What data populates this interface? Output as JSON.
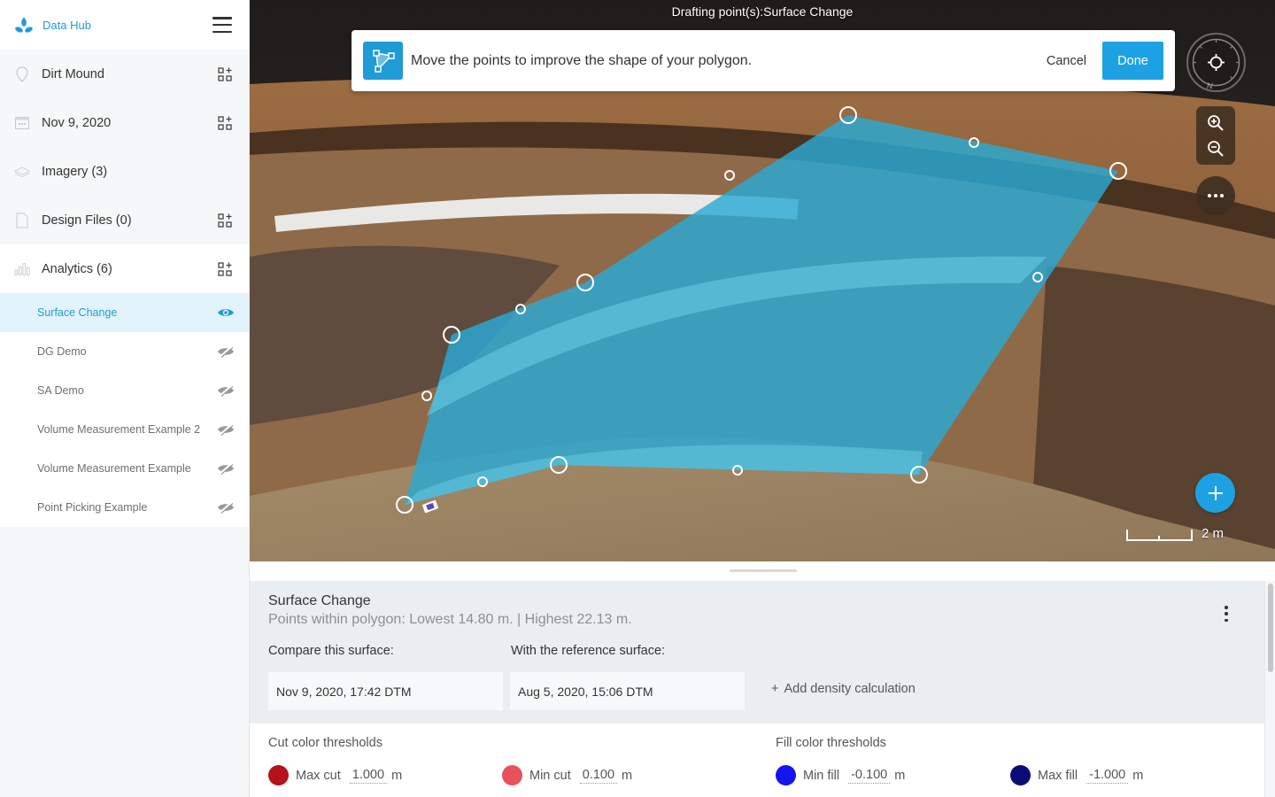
{
  "sidebar": {
    "app_title": "Data Hub",
    "logo_icon": "data-hub-logo-icon",
    "menu_icon": "hamburger-menu-icon",
    "items": [
      {
        "label": "Dirt Mound",
        "icon": "location-pin-icon",
        "has_add": true
      },
      {
        "label": "Nov 9, 2020",
        "icon": "calendar-icon",
        "has_add": true
      },
      {
        "label": "Imagery (3)",
        "icon": "layers-icon",
        "has_add": false
      },
      {
        "label": "Design Files (0)",
        "icon": "file-icon",
        "has_add": true
      },
      {
        "label": "Analytics (6)",
        "icon": "bar-chart-icon",
        "has_add": true
      }
    ],
    "analytics": [
      {
        "label": "Surface Change",
        "visible": true,
        "active": true
      },
      {
        "label": "DG Demo",
        "visible": false
      },
      {
        "label": "SA Demo",
        "visible": false
      },
      {
        "label": "Volume Measurement Example 2",
        "visible": false
      },
      {
        "label": "Volume Measurement Example",
        "visible": false
      },
      {
        "label": "Point Picking Example",
        "visible": false
      }
    ]
  },
  "map": {
    "mode_title": "Drafting point(s):Surface Change",
    "banner": {
      "icon": "polygon-edit-icon",
      "message": "Move the points to improve the shape of your polygon.",
      "cancel_label": "Cancel",
      "done_label": "Done"
    },
    "compass_label": "N",
    "scale_label": "2 m",
    "polygon_color": "#29a9d4"
  },
  "panel": {
    "title": "Surface Change",
    "subtitle": "Points within polygon: Lowest 14.80 m. | Highest 22.13 m.",
    "compare_label": "Compare this surface:",
    "compare_value": "Nov 9, 2020, 17:42 DTM",
    "reference_label": "With the reference surface:",
    "reference_value": "Aug 5, 2020, 15:06 DTM",
    "add_density": "Add density calculation",
    "add_density_plus": "+",
    "cut_title": "Cut color thresholds",
    "fill_title": "Fill color thresholds",
    "thresholds": [
      {
        "name": "Max cut",
        "value": "1.000",
        "unit": "m",
        "color": "#b5121b"
      },
      {
        "name": "Min cut",
        "value": "0.100",
        "unit": "m",
        "color": "#e8505b"
      },
      {
        "name": "Min fill",
        "value": "-0.100",
        "unit": "m",
        "color": "#1414f0"
      },
      {
        "name": "Max fill",
        "value": "-1.000",
        "unit": "m",
        "color": "#0c0c78"
      }
    ]
  },
  "colors": {
    "accent": "#1da1e2",
    "active_bg": "#e3f3fb"
  }
}
